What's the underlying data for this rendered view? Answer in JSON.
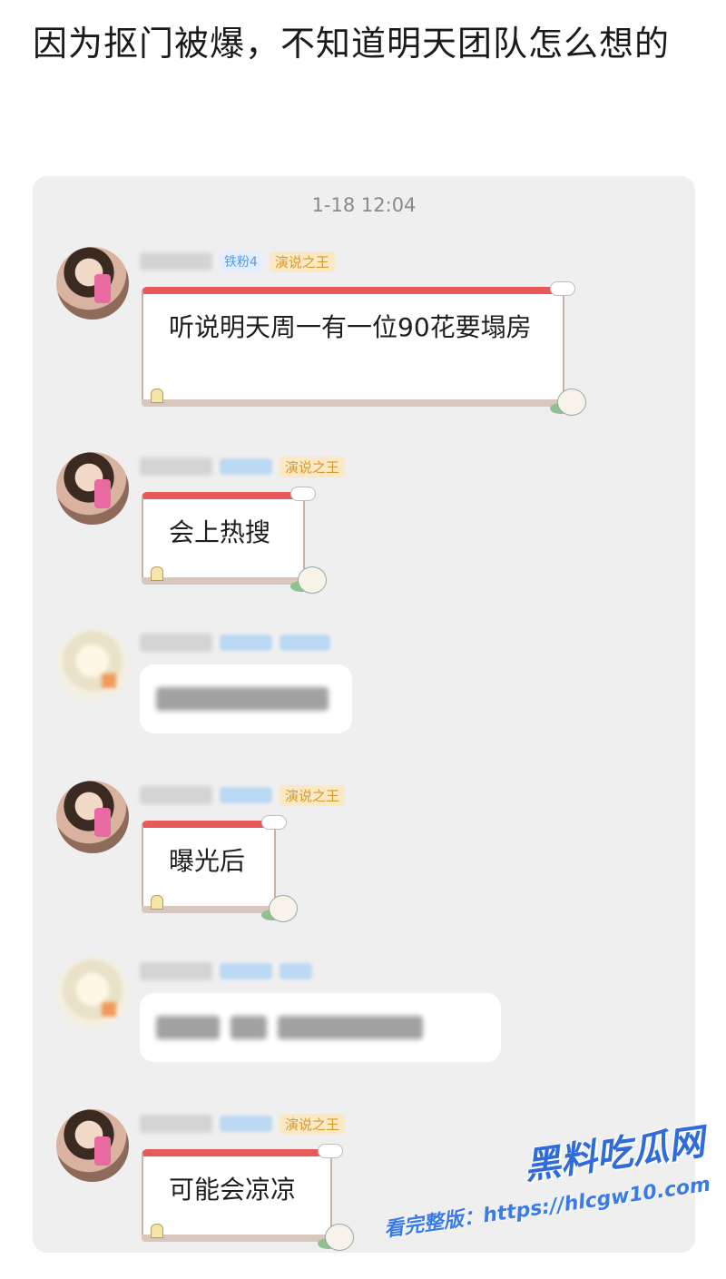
{
  "post": {
    "title": "因为抠门被爆，不知道明天团队怎么想的"
  },
  "chat": {
    "timestamp": "1-18 12:04",
    "messages": [
      {
        "kind": "framed",
        "fan_badge": "铁粉4",
        "title_badge": "演说之王",
        "text": "听说明天周一有一位90花要塌房"
      },
      {
        "kind": "framed",
        "fan_badge": "",
        "title_badge": "演说之王",
        "text": "会上热搜"
      },
      {
        "kind": "blurred"
      },
      {
        "kind": "framed",
        "fan_badge": "",
        "title_badge": "演说之王",
        "text": "曝光后"
      },
      {
        "kind": "blurred"
      },
      {
        "kind": "framed",
        "fan_badge": "",
        "title_badge": "演说之王",
        "text": "可能会凉凉"
      }
    ]
  },
  "watermark": {
    "logo": "黑料吃瓜网",
    "url_text": "看完整版：https://hlcgw10.com"
  }
}
